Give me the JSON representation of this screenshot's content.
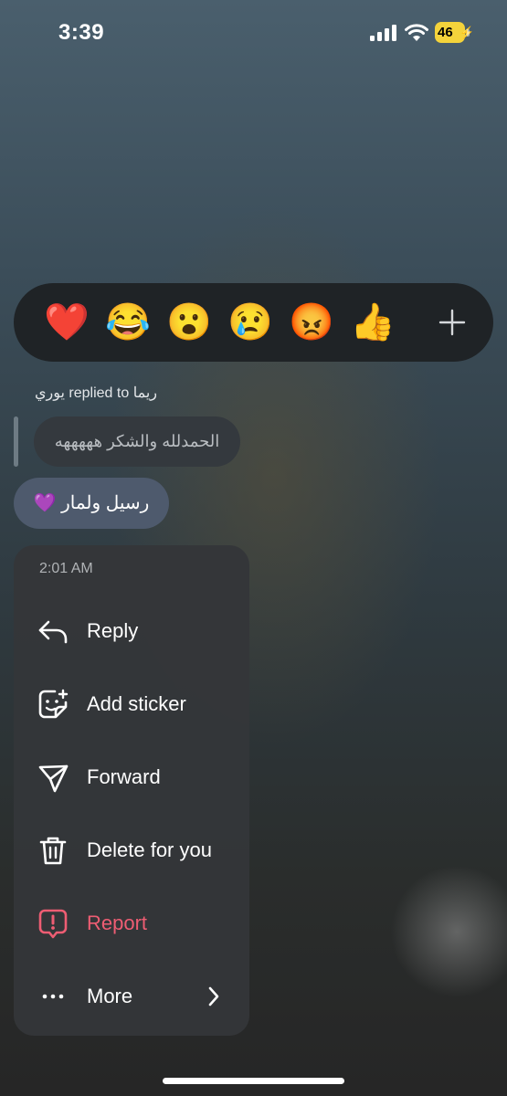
{
  "status_bar": {
    "time": "3:39",
    "battery_level": "46",
    "cellular_bars": 4
  },
  "reactions": [
    {
      "emoji": "❤️",
      "name": "red-heart"
    },
    {
      "emoji": "😂",
      "name": "tears-of-joy"
    },
    {
      "emoji": "😮",
      "name": "surprised"
    },
    {
      "emoji": "😢",
      "name": "crying"
    },
    {
      "emoji": "😡",
      "name": "angry"
    },
    {
      "emoji": "👍",
      "name": "thumbs-up"
    }
  ],
  "reply": {
    "meta": "يوري replied to ريما",
    "quoted_text": "الحمدلله والشكر هههههه"
  },
  "message": {
    "text": "رسيل ولمار 💜"
  },
  "menu": {
    "timestamp": "2:01 AM",
    "items": [
      {
        "label": "Reply",
        "icon": "reply-arrow-icon"
      },
      {
        "label": "Add sticker",
        "icon": "sticker-add-icon"
      },
      {
        "label": "Forward",
        "icon": "send-paper-plane-icon"
      },
      {
        "label": "Delete for you",
        "icon": "trash-icon"
      },
      {
        "label": "Report",
        "icon": "report-exclamation-icon"
      },
      {
        "label": "More",
        "icon": "more-dots-icon"
      }
    ]
  },
  "colors": {
    "danger": "#ee5d73",
    "bubble": "#4e5a6d",
    "menu_bg": "#343639",
    "battery": "#f4d33b"
  }
}
